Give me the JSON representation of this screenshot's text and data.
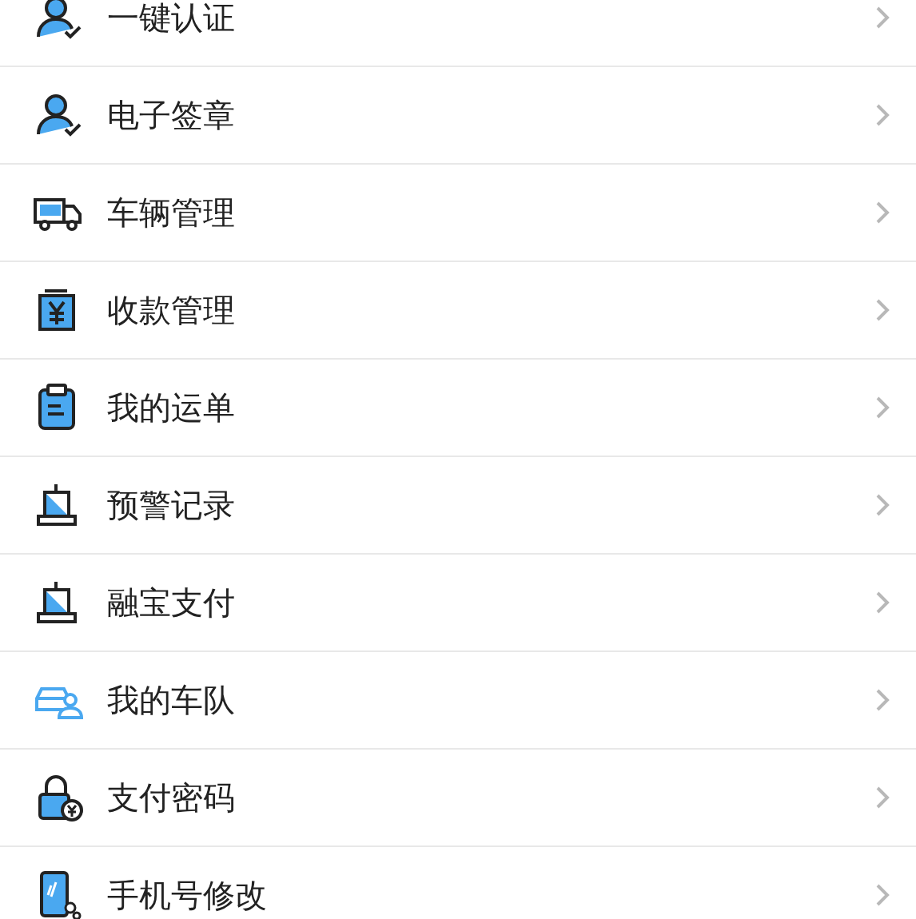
{
  "menu": [
    {
      "label": "一键认证",
      "kind": "person"
    },
    {
      "label": "电子签章",
      "kind": "person"
    },
    {
      "label": "车辆管理",
      "kind": "truck"
    },
    {
      "label": "收款管理",
      "kind": "yuan"
    },
    {
      "label": "我的运单",
      "kind": "clipboard"
    },
    {
      "label": "预警记录",
      "kind": "alarm"
    },
    {
      "label": "融宝支付",
      "kind": "alarm"
    },
    {
      "label": "我的车队",
      "kind": "fleet"
    },
    {
      "label": "支付密码",
      "kind": "lock"
    },
    {
      "label": "手机号修改",
      "kind": "phone"
    }
  ]
}
